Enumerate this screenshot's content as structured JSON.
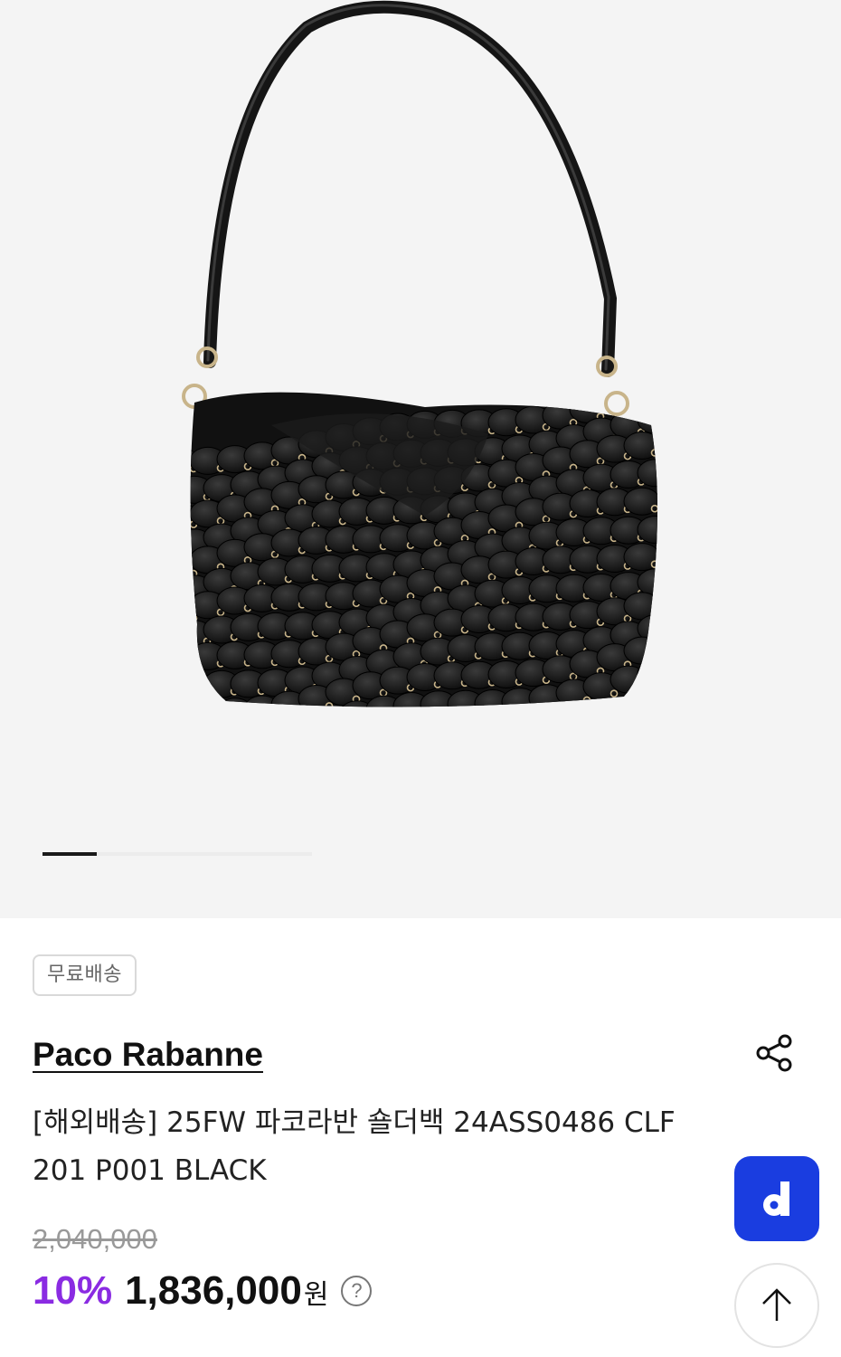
{
  "gallery": {
    "image_alt": "Paco Rabanne black disc shoulder bag",
    "current_slide": 1,
    "progress_fraction": 0.2
  },
  "badge": {
    "label": "무료배송"
  },
  "product": {
    "brand": "Paco Rabanne",
    "title": "[해외배송] 25FW 파코라반 숄더백 24ASS0486 CLF201 P001 BLACK",
    "original_price": "2,040,000",
    "discount": "10%",
    "sale_price": "1,836,000",
    "currency": "원",
    "help_symbol": "?"
  },
  "icons": {
    "share": "share-icon",
    "help": "question-circle-icon",
    "d_button": "d-logo-icon",
    "scroll_top": "arrow-up-icon"
  },
  "colors": {
    "discount": "#8a2be2",
    "d_button": "#1a3de0",
    "gallery_bg": "#f4f4f4"
  },
  "floating": {
    "d_label": "d"
  }
}
